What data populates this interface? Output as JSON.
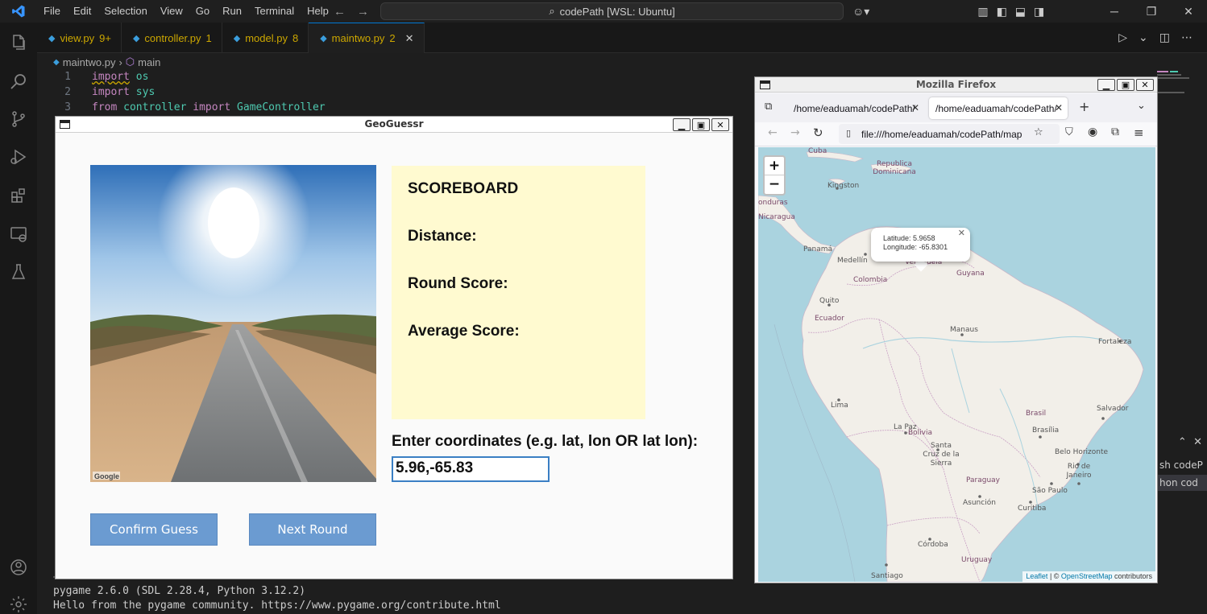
{
  "vscode": {
    "menu": [
      "File",
      "Edit",
      "Selection",
      "View",
      "Go",
      "Run",
      "Terminal",
      "Help"
    ],
    "command_center": "codePath [WSL: Ubuntu]",
    "tabs": [
      {
        "name": "view.py",
        "badge": "9+"
      },
      {
        "name": "controller.py",
        "badge": "1"
      },
      {
        "name": "model.py",
        "badge": "8"
      },
      {
        "name": "maintwo.py",
        "badge": "2"
      }
    ],
    "breadcrumb": {
      "file": "maintwo.py",
      "symbol": "main"
    },
    "code_lines": [
      {
        "num": "1",
        "kw": "import",
        "rest": "os"
      },
      {
        "num": "2",
        "kw": "import",
        "rest": "sys"
      },
      {
        "num": "3",
        "kw": "from",
        "mod": "controller",
        "kw2": "import",
        "rest": "GameController"
      }
    ],
    "terminal": {
      "line1": "pygame 2.6.0 (SDL 2.28.4, Python 3.12.2)",
      "line2": "Hello from the pygame community. https://www.pygame.org/contribute.html"
    },
    "right_panel": {
      "row1": "sh codeP",
      "row2": "hon cod"
    }
  },
  "geoguessr": {
    "title": "GeoGuessr",
    "scoreboard_title": "SCOREBOARD",
    "distance_label": "Distance:",
    "round_score_label": "Round Score:",
    "average_score_label": "Average Score:",
    "coord_prompt": "Enter coordinates (e.g. lat, lon OR lat lon):",
    "coord_value": "5.96,-65.83",
    "confirm_label": "Confirm Guess",
    "next_label": "Next Round",
    "streetview_logo": "Google"
  },
  "firefox": {
    "title": "Mozilla Firefox",
    "tabs": [
      "/home/eaduamah/codePath/",
      "/home/eaduamah/codePath/"
    ],
    "url": "file:///home/eaduamah/codePath/map",
    "zoom_in": "+",
    "zoom_out": "−",
    "popup": {
      "lat_line": "Latitude: 5.9658",
      "lon_line": "Longitude: -65.8301"
    },
    "attribution": {
      "leaflet": "Leaflet",
      "sep": " | © ",
      "osm": "OpenStreetMap",
      "suffix": " contributors"
    },
    "map_labels": [
      "Cuba",
      "Republica Dominicana",
      "Kingston",
      "onduras",
      "Nicaragua",
      "Panamá",
      "Medellín",
      "Colombia",
      "Venezuela",
      "Guyana",
      "Quito",
      "Ecuador",
      "Manaus",
      "Fortaleza",
      "Lima",
      "Brasil",
      "Salvador",
      "La Paz",
      "Bolivia",
      "Brasília",
      "Santa Cruz de la Sierra",
      "Belo Horizonte",
      "Rio de Janeiro",
      "Paraguay",
      "São Paulo",
      "Asunción",
      "Curitiba",
      "Córdoba",
      "Uruguay",
      "Santiago"
    ]
  }
}
